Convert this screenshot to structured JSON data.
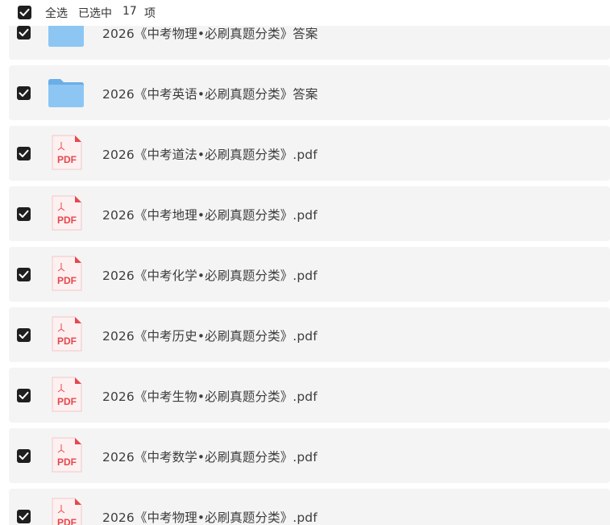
{
  "toolbar": {
    "select_all_label": "全选",
    "selected_prefix": "已选中",
    "selected_count": "17",
    "selected_suffix": "项"
  },
  "files": [
    {
      "name": "2026《中考物理•必刷真题分类》答案",
      "type": "folder",
      "checked": true
    },
    {
      "name": "2026《中考英语•必刷真题分类》答案",
      "type": "folder",
      "checked": true
    },
    {
      "name": "2026《中考道法•必刷真题分类》.pdf",
      "type": "pdf",
      "checked": true
    },
    {
      "name": "2026《中考地理•必刷真题分类》.pdf",
      "type": "pdf",
      "checked": true
    },
    {
      "name": "2026《中考化学•必刷真题分类》.pdf",
      "type": "pdf",
      "checked": true
    },
    {
      "name": "2026《中考历史•必刷真题分类》.pdf",
      "type": "pdf",
      "checked": true
    },
    {
      "name": "2026《中考生物•必刷真题分类》.pdf",
      "type": "pdf",
      "checked": true
    },
    {
      "name": "2026《中考数学•必刷真题分类》.pdf",
      "type": "pdf",
      "checked": true
    },
    {
      "name": "2026《中考物理•必刷真题分类》.pdf",
      "type": "pdf",
      "checked": true
    }
  ],
  "pdf_badge_text": "PDF",
  "colors": {
    "checkbox_fill": "#1f1f1f",
    "row_background": "#f4f4f5",
    "folder_blue": "#7ab8ee",
    "pdf_red": "#e5484d"
  }
}
